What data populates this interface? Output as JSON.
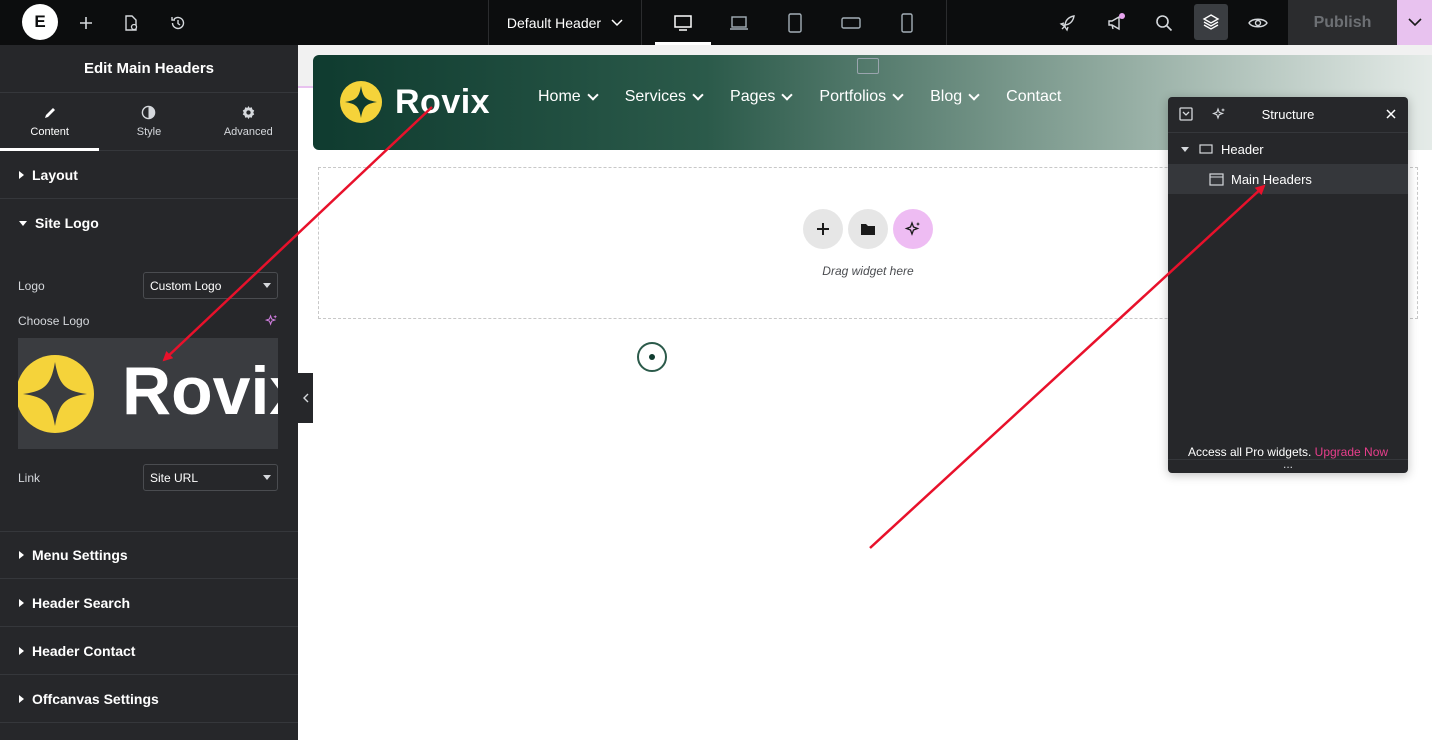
{
  "topbar": {
    "logo_letter": "E",
    "document_title": "Default Header",
    "publish_label": "Publish"
  },
  "panel": {
    "title": "Edit Main Headers",
    "tabs": [
      {
        "label": "Content",
        "icon": "pencil-icon",
        "active": true
      },
      {
        "label": "Style",
        "icon": "half-circle-icon",
        "active": false
      },
      {
        "label": "Advanced",
        "icon": "gear-icon",
        "active": false
      }
    ],
    "sections": {
      "layout": "Layout",
      "site_logo": "Site Logo",
      "menu_settings": "Menu Settings",
      "header_search": "Header Search",
      "header_contact": "Header Contact",
      "offcanvas_settings": "Offcanvas Settings"
    },
    "fields": {
      "logo_label": "Logo",
      "logo_value": "Custom Logo",
      "choose_logo_label": "Choose Logo",
      "logo_preview_text": "Rovix",
      "link_label": "Link",
      "link_value": "Site URL"
    }
  },
  "canvas": {
    "site_name": "Rovix",
    "nav": [
      {
        "label": "Home",
        "dropdown": true
      },
      {
        "label": "Services",
        "dropdown": true
      },
      {
        "label": "Pages",
        "dropdown": true
      },
      {
        "label": "Portfolios",
        "dropdown": true
      },
      {
        "label": "Blog",
        "dropdown": true
      },
      {
        "label": "Contact",
        "dropdown": false
      }
    ],
    "drop_label": "Drag widget here"
  },
  "structure": {
    "title": "Structure",
    "root": "Header",
    "child": "Main Headers",
    "footer_text": "Access all Pro widgets.",
    "footer_link": "Upgrade Now",
    "dots": "..."
  },
  "colors": {
    "accent_pink": "#e83e8c",
    "logo_yellow": "#f5d33a",
    "arrow_red": "#e8112b"
  }
}
